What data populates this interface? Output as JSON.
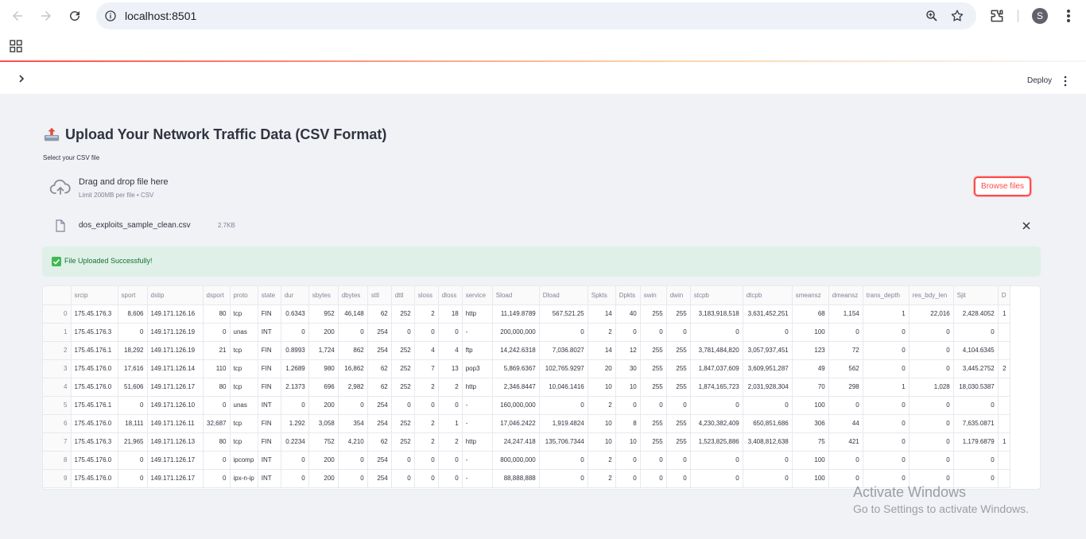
{
  "browser": {
    "url": "localhost:8501",
    "profile_initial": "S"
  },
  "app_header": {
    "deploy_label": "Deploy"
  },
  "main": {
    "title": "Upload Your Network Traffic Data (CSV Format)",
    "uploader": {
      "label": "Select your CSV file",
      "drop_text": "Drag and drop file here",
      "limit_text": "Limit 200MB per file • CSV",
      "browse_label": "Browse files"
    },
    "uploaded_file": {
      "name": "dos_exploits_sample_clean.csv",
      "size": "2.7KB"
    },
    "success_message": "File Uploaded Successfully!"
  },
  "dataframe": {
    "columns": [
      "",
      "srcip",
      "sport",
      "dstip",
      "dsport",
      "proto",
      "state",
      "dur",
      "sbytes",
      "dbytes",
      "sttl",
      "dttl",
      "sloss",
      "dloss",
      "service",
      "Sload",
      "Dload",
      "Spkts",
      "Dpkts",
      "swin",
      "dwin",
      "stcpb",
      "dtcpb",
      "smeansz",
      "dmeansz",
      "trans_depth",
      "res_bdy_len",
      "Sjit",
      "D"
    ],
    "rows": [
      [
        "0",
        "175.45.176.3",
        "8,606",
        "149.171.126.16",
        "80",
        "tcp",
        "FIN",
        "0.6343",
        "952",
        "46,148",
        "62",
        "252",
        "2",
        "18",
        "http",
        "11,149.8789",
        "567,521.25",
        "14",
        "40",
        "255",
        "255",
        "3,183,918,518",
        "3,631,452,251",
        "68",
        "1,154",
        "1",
        "22,016",
        "2,428.4052",
        "1"
      ],
      [
        "1",
        "175.45.176.3",
        "0",
        "149.171.126.19",
        "0",
        "unas",
        "INT",
        "0",
        "200",
        "0",
        "254",
        "0",
        "0",
        "0",
        "-",
        "200,000,000",
        "0",
        "2",
        "0",
        "0",
        "0",
        "0",
        "0",
        "100",
        "0",
        "0",
        "0",
        "0",
        ""
      ],
      [
        "2",
        "175.45.176.1",
        "18,292",
        "149.171.126.19",
        "21",
        "tcp",
        "FIN",
        "0.8993",
        "1,724",
        "862",
        "254",
        "252",
        "4",
        "4",
        "ftp",
        "14,242.6318",
        "7,036.8027",
        "14",
        "12",
        "255",
        "255",
        "3,781,484,820",
        "3,057,937,451",
        "123",
        "72",
        "0",
        "0",
        "4,104.6345",
        ""
      ],
      [
        "3",
        "175.45.176.0",
        "17,616",
        "149.171.126.14",
        "110",
        "tcp",
        "FIN",
        "1.2689",
        "980",
        "16,862",
        "62",
        "252",
        "7",
        "13",
        "pop3",
        "5,869.6367",
        "102,765.9297",
        "20",
        "30",
        "255",
        "255",
        "1,847,037,609",
        "3,609,951,287",
        "49",
        "562",
        "0",
        "0",
        "3,445.2752",
        "2"
      ],
      [
        "4",
        "175.45.176.0",
        "51,606",
        "149.171.126.17",
        "80",
        "tcp",
        "FIN",
        "2.1373",
        "696",
        "2,982",
        "62",
        "252",
        "2",
        "2",
        "http",
        "2,346.8447",
        "10,046.1416",
        "10",
        "10",
        "255",
        "255",
        "1,874,165,723",
        "2,031,928,304",
        "70",
        "298",
        "1",
        "1,028",
        "18,030.5387",
        ""
      ],
      [
        "5",
        "175.45.176.1",
        "0",
        "149.171.126.10",
        "0",
        "unas",
        "INT",
        "0",
        "200",
        "0",
        "254",
        "0",
        "0",
        "0",
        "-",
        "160,000,000",
        "0",
        "2",
        "0",
        "0",
        "0",
        "0",
        "0",
        "100",
        "0",
        "0",
        "0",
        "0",
        ""
      ],
      [
        "6",
        "175.45.176.0",
        "18,111",
        "149.171.126.11",
        "32,687",
        "tcp",
        "FIN",
        "1.292",
        "3,058",
        "354",
        "254",
        "252",
        "2",
        "1",
        "-",
        "17,046.2422",
        "1,919.4824",
        "10",
        "8",
        "255",
        "255",
        "4,230,382,409",
        "650,851,686",
        "306",
        "44",
        "0",
        "0",
        "7,635.0871",
        ""
      ],
      [
        "7",
        "175.45.176.3",
        "21,965",
        "149.171.126.13",
        "80",
        "tcp",
        "FIN",
        "0.2234",
        "752",
        "4,210",
        "62",
        "252",
        "2",
        "2",
        "http",
        "24,247.418",
        "135,706.7344",
        "10",
        "10",
        "255",
        "255",
        "1,523,825,886",
        "3,408,812,638",
        "75",
        "421",
        "0",
        "0",
        "1,179.6879",
        "1"
      ],
      [
        "8",
        "175.45.176.0",
        "0",
        "149.171.126.17",
        "0",
        "ipcomp",
        "INT",
        "0",
        "200",
        "0",
        "254",
        "0",
        "0",
        "0",
        "-",
        "800,000,000",
        "0",
        "2",
        "0",
        "0",
        "0",
        "0",
        "0",
        "100",
        "0",
        "0",
        "0",
        "0",
        ""
      ],
      [
        "9",
        "175.45.176.0",
        "0",
        "149.171.126.17",
        "0",
        "ipx-n-ip",
        "INT",
        "0",
        "200",
        "0",
        "254",
        "0",
        "0",
        "0",
        "-",
        "88,888,888",
        "0",
        "2",
        "0",
        "0",
        "0",
        "0",
        "0",
        "100",
        "0",
        "0",
        "0",
        "0",
        ""
      ]
    ]
  },
  "watermark": {
    "title": "Activate Windows",
    "subtitle": "Go to Settings to activate Windows."
  }
}
